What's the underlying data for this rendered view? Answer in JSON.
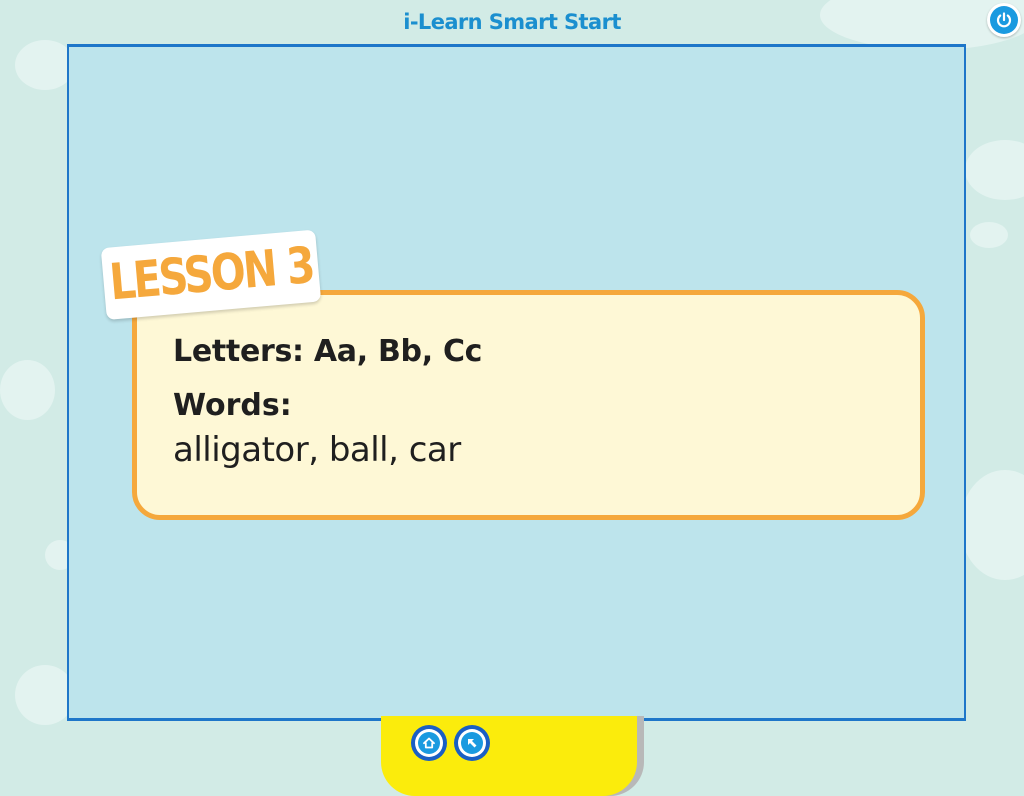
{
  "app": {
    "title": "i-Learn Smart Start"
  },
  "lesson": {
    "badge": "LESSON 3",
    "letters_line": "Letters: Aa, Bb, Cc",
    "words_heading": "Words:",
    "words_list": "alligator, ball, car"
  },
  "icons": {
    "power": "power-icon",
    "home": "home-icon",
    "back": "back-arrow-icon"
  },
  "colors": {
    "background": "#d2ebe6",
    "stage": "#bde4ec",
    "stage_border": "#1e76c9",
    "card_fill": "#fef8d6",
    "card_border": "#f5a83c",
    "title": "#1b8fcf",
    "nav_tray": "#fbec0c",
    "button_blue": "#1a9ae0"
  }
}
